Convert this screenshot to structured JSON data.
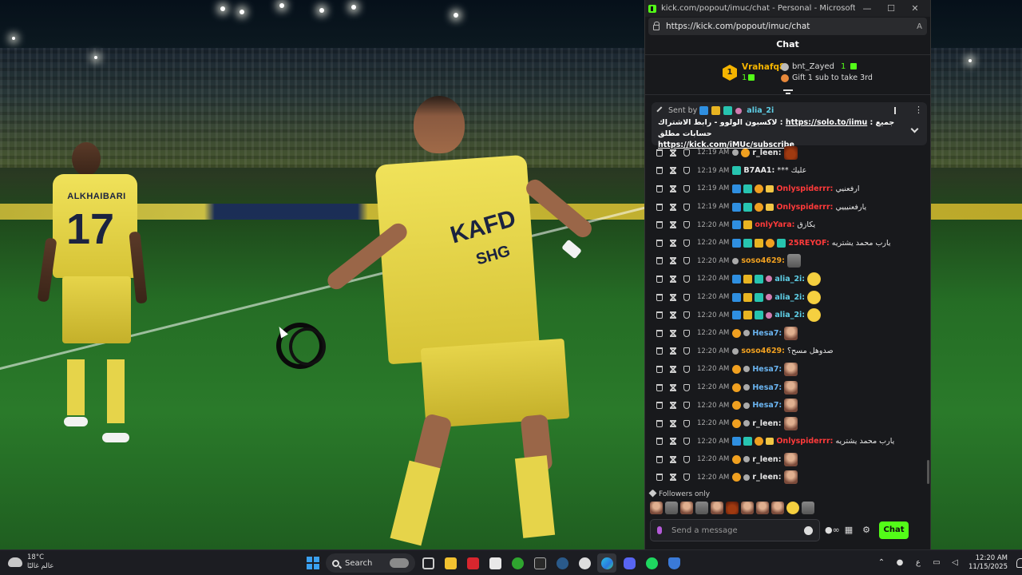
{
  "browser": {
    "title": "kick.com/popout/imuc/chat - Personal - Microsoft Edge",
    "url": "https://kick.com/popout/imuc/chat",
    "controls": {
      "minimize": "—",
      "maximize": "☐",
      "close": "✕"
    }
  },
  "chat": {
    "header": "Chat",
    "leaderboard": {
      "rank": "1",
      "first_user": "Vrahafq8",
      "first_count": "1",
      "second_user": "bnt_Zayed",
      "second_count": "1",
      "gift_text": "Gift 1 sub to take 3rd"
    },
    "pinned": {
      "sent_by_label": "Sent by",
      "user": "alia_2i",
      "message_prefix": "لاكسبون الولوو - رابط الاشتراك : ",
      "link1": "https://solo.to/iimu",
      "message_mid": " : جميع حسابات مطلق",
      "link2": "https://kick.com/iMUc/subscribe"
    },
    "messages": [
      {
        "time": "12:19 AM",
        "user": "r_leen:",
        "user_color": "#e8e8e8",
        "text": "",
        "emote": "fire"
      },
      {
        "time": "12:19 AM",
        "user": "B7AA1:",
        "user_color": "#e8e8e8",
        "text": "*** عليك",
        "emote": ""
      },
      {
        "time": "12:19 AM",
        "user": "Onlyspiderrr:",
        "user_color": "#ff3a3a",
        "text": "ارفعنيي",
        "emote": ""
      },
      {
        "time": "12:19 AM",
        "user": "Onlyspiderrr:",
        "user_color": "#ff3a3a",
        "text": "يارفعنيييي",
        "emote": ""
      },
      {
        "time": "12:20 AM",
        "user": "onlyYara:",
        "user_color": "#ff3a3a",
        "text": "يكازق",
        "emote": ""
      },
      {
        "time": "12:20 AM",
        "user": "25REYOF:",
        "user_color": "#ff3a3a",
        "text": "يارب محمد يشتريه",
        "emote": ""
      },
      {
        "time": "12:20 AM",
        "user": "soso4629:",
        "user_color": "#f0a020",
        "text": "",
        "emote": "cat"
      },
      {
        "time": "12:20 AM",
        "user": "alia_2i:",
        "user_color": "#5fd0e8",
        "text": "",
        "emote": "face"
      },
      {
        "time": "12:20 AM",
        "user": "alia_2i:",
        "user_color": "#5fd0e8",
        "text": "",
        "emote": "face"
      },
      {
        "time": "12:20 AM",
        "user": "alia_2i:",
        "user_color": "#5fd0e8",
        "text": "",
        "emote": "face"
      },
      {
        "time": "12:20 AM",
        "user": "Hesa7:",
        "user_color": "#6ab4f0",
        "text": "",
        "emote": "avatar"
      },
      {
        "time": "12:20 AM",
        "user": "soso4629:",
        "user_color": "#f0a020",
        "text": "صدوهل مسح؟",
        "emote": ""
      },
      {
        "time": "12:20 AM",
        "user": "Hesa7:",
        "user_color": "#6ab4f0",
        "text": "",
        "emote": "avatar"
      },
      {
        "time": "12:20 AM",
        "user": "Hesa7:",
        "user_color": "#6ab4f0",
        "text": "",
        "emote": "avatar"
      },
      {
        "time": "12:20 AM",
        "user": "Hesa7:",
        "user_color": "#6ab4f0",
        "text": "",
        "emote": "avatar"
      },
      {
        "time": "12:20 AM",
        "user": "r_leen:",
        "user_color": "#e8e8e8",
        "text": "",
        "emote": "avatar"
      },
      {
        "time": "12:20 AM",
        "user": "Onlyspiderrr:",
        "user_color": "#ff3a3a",
        "text": "يارب محمد يشتريه",
        "emote": ""
      },
      {
        "time": "12:20 AM",
        "user": "r_leen:",
        "user_color": "#e8e8e8",
        "text": "",
        "emote": "avatar"
      },
      {
        "time": "12:20 AM",
        "user": "r_leen:",
        "user_color": "#e8e8e8",
        "text": "",
        "emote": "avatar"
      }
    ],
    "followers_only": "Followers only",
    "input_placeholder": "Send a message",
    "send_label": "Chat"
  },
  "stream": {
    "player1_name": "ALKHAIBARI",
    "player1_number": "17",
    "player2_sponsor": "KAFD",
    "player2_sponsor2": "SHG"
  },
  "taskbar": {
    "temperature": "18°C",
    "weather_text": "عالم غالبًا",
    "search_label": "Search",
    "time": "12:20 AM",
    "date": "11/15/2025",
    "lang": "ع"
  },
  "colors": {
    "kick_green": "#53fc18",
    "chat_bg": "#18191c",
    "username_red": "#ff3a3a",
    "username_cyan": "#5fd0e8"
  }
}
